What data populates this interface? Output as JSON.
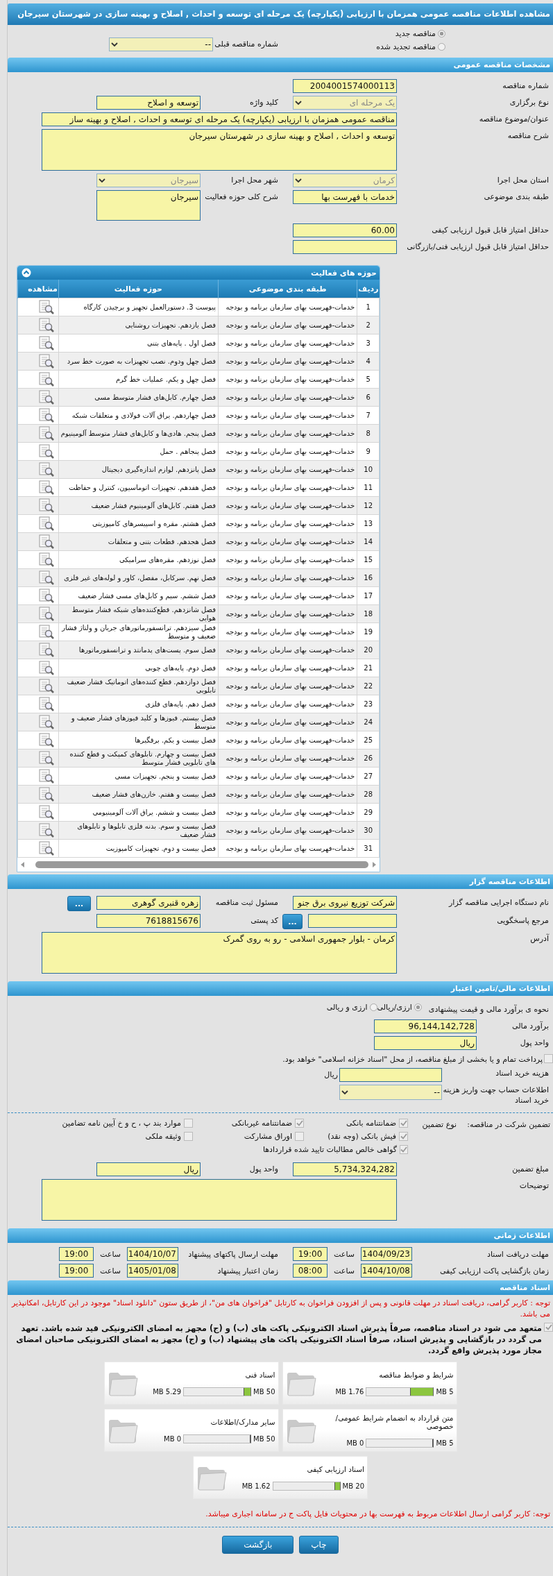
{
  "title": "مشاهده اطلاعات مناقصه عمومی همزمان با ارزیابی (یکپارچه) یک مرحله ای توسعه و احداث , اصلاح و بهینه سازی در شهرستان سیرجان",
  "tender_status": {
    "options": [
      {
        "label": "مناقصه جدید",
        "selected": true
      },
      {
        "label": "مناقصه تجدید شده",
        "selected": false
      }
    ],
    "previous_number": {
      "label": "شماره مناقصه قبلی",
      "value": "--",
      "kind": "select"
    }
  },
  "general": {
    "header": "مشخصات مناقصه عمومی",
    "rows": [
      [
        {
          "label": "شماره مناقصه",
          "value": "2004001574000113",
          "kind": "input"
        }
      ],
      [
        {
          "label": "نوع برگزاری",
          "value": "یک مرحله ای",
          "kind": "select",
          "disabled": true
        },
        {
          "label": "کلید واژه",
          "value": "توسعه و اصلاح",
          "kind": "input"
        }
      ],
      [
        {
          "label": "عنوان/موضوع مناقصه",
          "value": "مناقصه عمومی همزمان با ارزیابی (یکپارچه) یک مرحله ای توسعه و احداث , اصلاح و بهینه ساز",
          "kind": "wide-input"
        }
      ],
      [
        {
          "label": "شرح مناقصه",
          "value": "توسعه و احداث , اصلاح و بهینه سازی در شهرستان سیرجان",
          "kind": "wide-textarea"
        }
      ],
      [
        {
          "label": "استان محل اجرا",
          "value": "کرمان",
          "kind": "select",
          "disabled": true
        },
        {
          "label": "شهر محل اجرا",
          "value": "سیرجان",
          "kind": "select",
          "disabled": true
        }
      ],
      [
        {
          "label": "طبقه بندی موضوعی",
          "value": "خدمات با فهرست بها",
          "kind": "input"
        },
        {
          "label": "شرح کلی حوزه فعالیت",
          "value": "سیرجان",
          "kind": "textarea"
        }
      ],
      [
        {
          "label": "حداقل امتیاز قابل قبول ارزیابی کیفی",
          "value": "60.00",
          "kind": "input"
        }
      ],
      [
        {
          "label": "حداقل امتیاز قابل قبول ارزیابی فنی/بازرگانی",
          "kind": "input"
        }
      ]
    ]
  },
  "activities": {
    "header": "حوزه های فعالیت",
    "columns": [
      "ردیف",
      "طبقه بندی موضوعی",
      "حوزه فعالیت",
      "مشاهده"
    ],
    "rows": [
      {
        "index": "1",
        "category": "خدمات-فهرست بهای سازمان برنامه و بودجه",
        "activity": "پیوست 3. دستورالعمل تجهیز و برچیدن کارگاه"
      },
      {
        "index": "2",
        "category": "خدمات-فهرست بهای سازمان برنامه و بودجه",
        "activity": "فصل یازدهم. تجهیزات روشنایی"
      },
      {
        "index": "3",
        "category": "خدمات-فهرست بهای سازمان برنامه و بودجه",
        "activity": "فصل اول . پایه‌های بتنی"
      },
      {
        "index": "4",
        "category": "خدمات-فهرست بهای سازمان برنامه و بودجه",
        "activity": "فصل چهل ودوم. نصب تجهیزات به صورت خط سرد"
      },
      {
        "index": "5",
        "category": "خدمات-فهرست بهای سازمان برنامه و بودجه",
        "activity": "فصل چهل و یکم. عملیات خط گرم"
      },
      {
        "index": "6",
        "category": "خدمات-فهرست بهای سازمان برنامه و بودجه",
        "activity": "فصل چهارم. کابل‌های فشار متوسط مسی"
      },
      {
        "index": "7",
        "category": "خدمات-فهرست بهای سازمان برنامه و بودجه",
        "activity": "فصل چهاردهم. یراق آلات فولادی و متعلقات شبکه"
      },
      {
        "index": "8",
        "category": "خدمات-فهرست بهای سازمان برنامه و بودجه",
        "activity": "فصل پنجم. هادی‌ها و کابل‌های فشار متوسط آلومینیوم"
      },
      {
        "index": "9",
        "category": "خدمات-فهرست بهای سازمان برنامه و بودجه",
        "activity": "فصل پنجاهم . حمل"
      },
      {
        "index": "10",
        "category": "خدمات-فهرست بهای سازمان برنامه و بودجه",
        "activity": "فصل پانزدهم. لوازم اندازه‌گیری دیجیتال"
      },
      {
        "index": "11",
        "category": "خدمات-فهرست بهای سازمان برنامه و بودجه",
        "activity": "فصل هفدهم. تجهیزات اتوماسیون، کنترل و حفاظت"
      },
      {
        "index": "12",
        "category": "خدمات-فهرست بهای سازمان برنامه و بودجه",
        "activity": "فصل هفتم. کابل‌های آلومینیوم فشار ضعیف"
      },
      {
        "index": "13",
        "category": "خدمات-فهرست بهای سازمان برنامه و بودجه",
        "activity": "فصل هشتم. مقره و اسپیسرهای کامپوزیتی"
      },
      {
        "index": "14",
        "category": "خدمات-فهرست بهای سازمان برنامه و بودجه",
        "activity": "فصل هجدهم. قطعات بتنی و متعلقات"
      },
      {
        "index": "15",
        "category": "خدمات-فهرست بهای سازمان برنامه و بودجه",
        "activity": "فصل نوزدهم. مقره‌های سرامیکی"
      },
      {
        "index": "16",
        "category": "خدمات-فهرست بهای سازمان برنامه و بودجه",
        "activity": "فصل نهم. سرکابل، مفصل، کاور و لوله‌های غیر فلزی"
      },
      {
        "index": "17",
        "category": "خدمات-فهرست بهای سازمان برنامه و بودجه",
        "activity": "فصل ششم. سیم و کابل‌های مسی فشار ضعیف"
      },
      {
        "index": "18",
        "category": "خدمات-فهرست بهای سازمان برنامه و بودجه",
        "activity": "فصل شانزدهم. قطع‌کننده‌های شبکه فشار متوسط هوایی"
      },
      {
        "index": "19",
        "category": "خدمات-فهرست بهای سازمان برنامه و بودجه",
        "activity": "فصل سیزدهم. ترانسفورماتورهای جریان و ولتاژ فشار ضعیف و متوسط"
      },
      {
        "index": "20",
        "category": "خدمات-فهرست بهای سازمان برنامه و بودجه",
        "activity": "فصل سوم. پست‌های پدمانتد و ترانسفورماتورها"
      },
      {
        "index": "21",
        "category": "خدمات-فهرست بهای سازمان برنامه و بودجه",
        "activity": "فصل دوم. پایه‌های چوبی"
      },
      {
        "index": "22",
        "category": "خدمات-فهرست بهای سازمان برنامه و بودجه",
        "activity": "فصل دوازدهم. قطع کننده‌های اتوماتیک فشار ضعیف تابلویی"
      },
      {
        "index": "23",
        "category": "خدمات-فهرست بهای سازمان برنامه و بودجه",
        "activity": "فصل دهم. پایه‌های فلزی"
      },
      {
        "index": "24",
        "category": "خدمات-فهرست بهای سازمان برنامه و بودجه",
        "activity": "فصل بیستم. فیوزها و کلید فیوزهای فشار ضعیف و متوسط"
      },
      {
        "index": "25",
        "category": "خدمات-فهرست بهای سازمان برنامه و بودجه",
        "activity": "فصل بیست و یکم. برقگیرها"
      },
      {
        "index": "26",
        "category": "خدمات-فهرست بهای سازمان برنامه و بودجه",
        "activity": "فصل بیست و چهارم. تابلوهای کمپکت و قطع کننده های تابلویی فشار متوسط"
      },
      {
        "index": "27",
        "category": "خدمات-فهرست بهای سازمان برنامه و بودجه",
        "activity": "فصل بیست و پنجم. تجهیزات مسی"
      },
      {
        "index": "28",
        "category": "خدمات-فهرست بهای سازمان برنامه و بودجه",
        "activity": "فصل بیست و هفتم. خازن‌های فشار ضعیف"
      },
      {
        "index": "29",
        "category": "خدمات-فهرست بهای سازمان برنامه و بودجه",
        "activity": "فصل بیست و ششم. یراق آلات آلومینیومی"
      },
      {
        "index": "30",
        "category": "خدمات-فهرست بهای سازمان برنامه و بودجه",
        "activity": "فصل بیست و سوم. بدنه فلزی تابلوها و تابلوهای فشار ضعیف"
      },
      {
        "index": "31",
        "category": "خدمات-فهرست بهای سازمان برنامه و بودجه",
        "activity": "فصل بیست و دوم. تجهیزات کامپوزیت"
      }
    ]
  },
  "organizer": {
    "header": "اطلاعات مناقصه گزار",
    "rows": [
      [
        {
          "label": "نام دستگاه اجرایی مناقصه گزار",
          "value": "شرکت توزیع نیروی برق جنو",
          "kind": "input"
        },
        {
          "label": "مسئول ثبت مناقصه",
          "value": "زهره قنبری گوهری",
          "kind": "input",
          "button": "..."
        }
      ],
      [
        {
          "label": "مرجع پاسخگویی",
          "kind": "input",
          "button": "..."
        },
        {
          "label": "کد پستی",
          "value": "7618815676",
          "kind": "input"
        }
      ],
      [
        {
          "label": "آدرس",
          "value": "کرمان - بلوار جمهوری اسلامی - رو به روی گمرک",
          "kind": "wide-textarea"
        }
      ]
    ]
  },
  "financial": {
    "header": "اطلاعات مالی/تامین اعتبار",
    "estimate_method": {
      "label": "نحوه ی برآورد مالی و قیمت پیشنهادی",
      "options": [
        {
          "label": "ارزی/ریالی",
          "selected": true
        },
        {
          "label": "ارزی و ریالی",
          "selected": false
        }
      ]
    },
    "rows": [
      [
        {
          "label": "برآورد مالی",
          "value": "96,144,142,728",
          "kind": "input"
        }
      ],
      [
        {
          "label": "واحد پول",
          "value": "ریال",
          "kind": "input"
        }
      ]
    ],
    "treasury": {
      "label": "پرداخت تمام و یا بخشی از مبلغ مناقصه، از محل \"اسناد خزانه اسلامی\" خواهد بود.",
      "checked": false
    },
    "purchase_rows": [
      [
        {
          "label": "هزینه خرید اسناد",
          "kind": "input",
          "unit": "ریال"
        }
      ],
      [
        {
          "label": "اطلاعات حساب جهت واریز هزینه خرید اسناد",
          "value": "--",
          "kind": "long-select"
        }
      ]
    ],
    "guarantee": {
      "label": "تضمین شرکت در مناقصه:",
      "type_label": "نوع تضمین",
      "options": [
        {
          "label": "ضمانتنامه بانکی",
          "checked": true
        },
        {
          "label": "ضمانتنامه غیربانکی",
          "checked": true
        },
        {
          "label": "موارد بند پ ، ح و خ آیین نامه تضامین",
          "checked": false
        },
        {
          "label": "فیش بانکی (وجه نقد)",
          "checked": true
        },
        {
          "label": "اوراق مشارکت",
          "checked": false
        },
        {
          "label": "وثیقه ملکی",
          "checked": false
        },
        {
          "label": "گواهی خالص مطالبات تایید شده قراردادها",
          "checked": true
        }
      ]
    },
    "amount_rows": [
      [
        {
          "label": "مبلغ تضمین",
          "value": "5,734,324,282",
          "kind": "input"
        },
        {
          "label": "واحد پول",
          "value": "ریال",
          "kind": "input"
        }
      ],
      [
        {
          "label": "توضیحات",
          "kind": "wide-textarea"
        }
      ]
    ]
  },
  "timing": {
    "header": "اطلاعات زمانی",
    "rows": [
      [
        {
          "label": "مهلت دریافت اسناد",
          "date": "1404/09/23",
          "hour_label": "ساعت",
          "hour": "19:00"
        },
        {
          "label": "مهلت ارسال پاکتهای پیشنهاد",
          "date": "1404/10/07",
          "hour_label": "ساعت",
          "hour": "19:00"
        }
      ],
      [
        {
          "label": "زمان بازگشایی پاکت ارزیابی کیفی",
          "date": "1404/10/08",
          "hour_label": "ساعت",
          "hour": "08:00"
        },
        {
          "label": "زمان اعتبار پیشنهاد",
          "date": "1405/01/08",
          "hour_label": "ساعت",
          "hour": "19:00"
        }
      ]
    ]
  },
  "documents": {
    "header": "اسناد مناقصه",
    "notice": "توجه : کاربر گرامی، دریافت اسناد در مهلت قانونی و پس از افزودن فراخوان به کارتابل \"فراخوان های من\"، از طریق ستون \"دانلود اسناد\" موجود در این کارتابل، امکانپذیر می باشد.",
    "commitment": {
      "text": "متعهد می شود در اسناد مناقصه، صرفاً پذیرش اسناد الکترونیکی پاکت های (ب) و (ج) مجهز به امضای الکترونیکی قید شده باشد. تعهد می گردد در بازگشایی و پذیرش اسناد، صرفاً اسناد الکترونیکی پاکت های پیشنهاد (ب) و (ج) مجهز به امضای الکترونیکی صاحبان امضای مجاز مورد پذیرش واقع گردد.",
      "checked": true
    },
    "files": [
      {
        "title": "شرایط و ضوابط مناقصه",
        "max": "5 MB",
        "size": "1.76 MB",
        "level": 0.352
      },
      {
        "title": "اسناد فنی",
        "max": "50 MB",
        "size": "5.29 MB",
        "level": 0.106
      },
      {
        "title": "متن قرارداد به انضمام شرایط عمومی/خصوصی",
        "max": "5 MB",
        "size": "0 MB",
        "level": 0
      },
      {
        "title": "سایر مدارک/اطلاعات",
        "max": "50 MB",
        "size": "0 MB",
        "level": 0
      },
      {
        "title": "اسناد ارزیابی کیفی",
        "max": "20 MB",
        "size": "1.62 MB",
        "level": 0.081
      }
    ],
    "footer_note": "توجه: کاربر گرامی ارسال اطلاعات مربوط به فهرست بها در محتویات فایل پاکت ج در سامانه اجباری میباشد."
  },
  "buttons": [
    {
      "label": "چاپ"
    },
    {
      "label": "بازگشت"
    }
  ]
}
